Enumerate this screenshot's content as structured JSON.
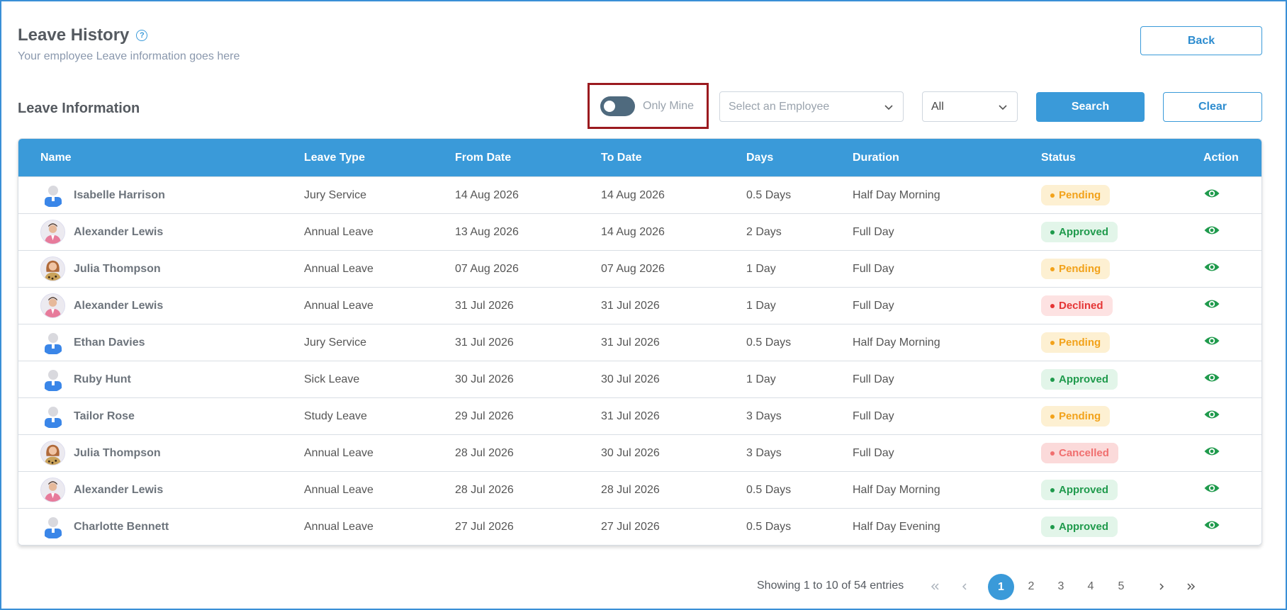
{
  "header": {
    "title": "Leave History",
    "subtitle": "Your employee Leave information goes here",
    "back_label": "Back"
  },
  "filters": {
    "section_title": "Leave Information",
    "toggle_label": "Only Mine",
    "toggle_on": false,
    "employee_placeholder": "Select an Employee",
    "status_value": "All",
    "search_label": "Search",
    "clear_label": "Clear"
  },
  "table": {
    "columns": [
      "Name",
      "Leave Type",
      "From Date",
      "To Date",
      "Days",
      "Duration",
      "Status",
      "Action"
    ],
    "rows": [
      {
        "name": "Isabelle Harrison",
        "avatar": "generic",
        "type": "Jury Service",
        "from": "14 Aug 2026",
        "to": "14 Aug 2026",
        "days": "0.5 Days",
        "duration": "Half Day Morning",
        "status": "Pending"
      },
      {
        "name": "Alexander Lewis",
        "avatar": "photo-male",
        "type": "Annual Leave",
        "from": "13 Aug 2026",
        "to": "14 Aug 2026",
        "days": "2 Days",
        "duration": "Full Day",
        "status": "Approved"
      },
      {
        "name": "Julia Thompson",
        "avatar": "photo-female",
        "type": "Annual Leave",
        "from": "07 Aug 2026",
        "to": "07 Aug 2026",
        "days": "1 Day",
        "duration": "Full Day",
        "status": "Pending"
      },
      {
        "name": "Alexander Lewis",
        "avatar": "photo-male",
        "type": "Annual Leave",
        "from": "31 Jul 2026",
        "to": "31 Jul 2026",
        "days": "1 Day",
        "duration": "Full Day",
        "status": "Declined"
      },
      {
        "name": "Ethan Davies",
        "avatar": "generic",
        "type": "Jury Service",
        "from": "31 Jul 2026",
        "to": "31 Jul 2026",
        "days": "0.5 Days",
        "duration": "Half Day Morning",
        "status": "Pending"
      },
      {
        "name": "Ruby Hunt",
        "avatar": "generic",
        "type": "Sick Leave",
        "from": "30 Jul 2026",
        "to": "30 Jul 2026",
        "days": "1 Day",
        "duration": "Full Day",
        "status": "Approved"
      },
      {
        "name": "Tailor Rose",
        "avatar": "generic",
        "type": "Study Leave",
        "from": "29 Jul 2026",
        "to": "31 Jul 2026",
        "days": "3 Days",
        "duration": "Full Day",
        "status": "Pending"
      },
      {
        "name": "Julia Thompson",
        "avatar": "photo-female",
        "type": "Annual Leave",
        "from": "28 Jul 2026",
        "to": "30 Jul 2026",
        "days": "3 Days",
        "duration": "Full Day",
        "status": "Cancelled"
      },
      {
        "name": "Alexander Lewis",
        "avatar": "photo-male",
        "type": "Annual Leave",
        "from": "28 Jul 2026",
        "to": "28 Jul 2026",
        "days": "0.5 Days",
        "duration": "Half Day Morning",
        "status": "Approved"
      },
      {
        "name": "Charlotte Bennett",
        "avatar": "generic",
        "type": "Annual Leave",
        "from": "27 Jul 2026",
        "to": "27 Jul 2026",
        "days": "0.5 Days",
        "duration": "Half Day Evening",
        "status": "Approved"
      }
    ]
  },
  "pagination": {
    "showing": "Showing 1 to 10 of 54 entries",
    "pages": [
      "1",
      "2",
      "3",
      "4",
      "5"
    ],
    "current": "1"
  },
  "colors": {
    "primary": "#3a9ad9",
    "highlight_border": "#9b1a1f",
    "approved": "#1f9a4c",
    "pending": "#f2a21a",
    "declined": "#e53535",
    "cancelled": "#f06f6f"
  }
}
